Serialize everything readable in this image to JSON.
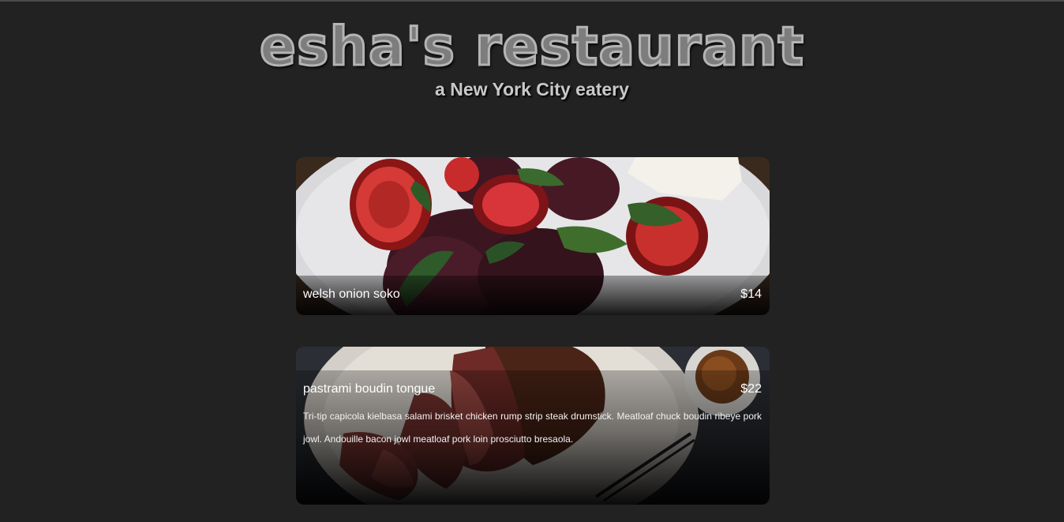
{
  "header": {
    "title": "esha's restaurant",
    "subtitle": "a New York City eatery"
  },
  "menu": {
    "items": [
      {
        "name": "welsh onion soko",
        "price": "$14",
        "description": "",
        "image": "roasted-beets-peppers-photo"
      },
      {
        "name": "pastrami boudin tongue",
        "price": "$22",
        "description": "Tri-tip capicola kielbasa salami brisket chicken rump strip steak drumstick. Meatloaf chuck boudin ribeye pork jowl. Andouille bacon jowl meatloaf pork loin prosciutto bresaola.",
        "image": "sliced-steak-photo"
      }
    ]
  },
  "colors": {
    "background": "#222222",
    "title": "#7d7d7d",
    "subtitle": "#c9c9c9",
    "caption_text": "#ffffff"
  }
}
